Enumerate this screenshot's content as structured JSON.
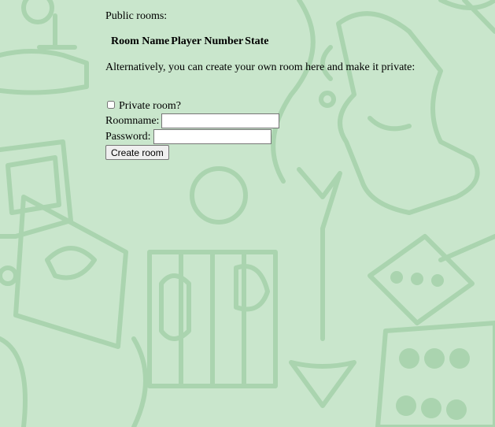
{
  "public_rooms_label": "Public rooms:",
  "table_headers": [
    "Room Name",
    "Player Number",
    "State"
  ],
  "alt_text": "Alternatively, you can create your own room here and make it private:",
  "private_label": "Private room?",
  "roomname_label": "Roomname:",
  "password_label": "Password:",
  "create_button": "Create room",
  "roomname_value": "",
  "password_value": "",
  "colors": {
    "background": "#c9e6cc",
    "doodle": "#a9d3ae"
  }
}
